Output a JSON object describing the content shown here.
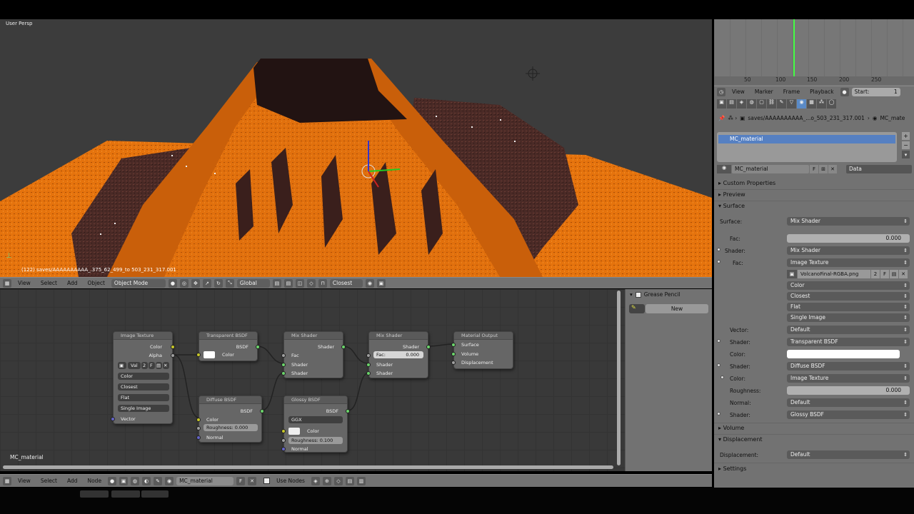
{
  "viewport": {
    "label": "User Persp",
    "status": "(122) saves/AAAAAAAAAA_.375_62_499_to 503_231_317.001"
  },
  "viewport_header": {
    "view": "View",
    "select": "Select",
    "add": "Add",
    "object": "Object",
    "mode": "Object Mode",
    "orientation": "Global",
    "snap": "Closest"
  },
  "node_editor": {
    "material_label": "MC_material",
    "nodes": {
      "image_texture": {
        "title": "Image Texture",
        "out_color": "Color",
        "out_alpha": "Alpha",
        "img_name": "Val",
        "img_users": "2",
        "fake": "F",
        "interp": "Color",
        "extension": "Closest",
        "projection": "Flat",
        "source": "Single Image",
        "in_vector": "Vector"
      },
      "transparent": {
        "title": "Transparent BSDF",
        "out": "BSDF",
        "in_color": "Color"
      },
      "diffuse": {
        "title": "Diffuse BSDF",
        "out": "BSDF",
        "in_color": "Color",
        "roughness": "Roughness:  0.000",
        "in_normal": "Normal"
      },
      "mix1": {
        "title": "Mix Shader",
        "out": "Shader",
        "in_fac": "Fac",
        "in_s1": "Shader",
        "in_s2": "Shader"
      },
      "glossy": {
        "title": "Glossy BSDF",
        "out": "BSDF",
        "dist": "GGX",
        "in_color": "Color",
        "roughness": "Roughness:  0.100",
        "in_normal": "Normal"
      },
      "mix2": {
        "title": "Mix Shader",
        "out": "Shader",
        "fac_label": "Fac:",
        "fac_val": "0.000",
        "in_s1": "Shader",
        "in_s2": "Shader"
      },
      "output": {
        "title": "Material Output",
        "surface": "Surface",
        "volume": "Volume",
        "displacement": "Displacement"
      }
    }
  },
  "node_header": {
    "view": "View",
    "select": "Select",
    "add": "Add",
    "node": "Node",
    "material": "MC_material",
    "fake": "F",
    "use_nodes": "Use Nodes"
  },
  "grease_pencil": {
    "title": "Grease Pencil",
    "new_label": "New"
  },
  "timeline": {
    "ticks": [
      "50",
      "100",
      "150",
      "200",
      "250"
    ],
    "menu": [
      "View",
      "Marker",
      "Frame",
      "Playback"
    ],
    "start_label": "Start:",
    "start_val": "1"
  },
  "properties": {
    "breadcrumb_path": "saves/AAAAAAAAAA_...o_503_231_317.001",
    "breadcrumb_mat": "MC_mate",
    "slot": "MC_material",
    "datablock": "MC_material",
    "fake": "F",
    "link": "Data",
    "sections": {
      "custom": "Custom Properties",
      "preview": "Preview",
      "surface": "Surface",
      "volume": "Volume",
      "displacement": "Displacement",
      "settings": "Settings"
    },
    "rows": {
      "surface_lbl": "Surface:",
      "surface_val": "Mix Shader",
      "fac_lbl": "Fac:",
      "fac_val": "0.000",
      "shader1_lbl": "Shader:",
      "shader1_val": "Mix Shader",
      "fac2_lbl": "Fac:",
      "fac2_val": "Image Texture",
      "img_name": "VolcanoFinal-RGBA.png",
      "img_users": "2",
      "img_fake": "F",
      "opt1": "Color",
      "opt2": "Closest",
      "opt3": "Flat",
      "opt4": "Single Image",
      "vector_lbl": "Vector:",
      "vector_val": "Default",
      "shader2_lbl": "Shader:",
      "shader2_val": "Transparent BSDF",
      "color_lbl": "Color:",
      "shader3_lbl": "Shader:",
      "shader3_val": "Diffuse BSDF",
      "color2_lbl": "Color:",
      "color2_val": "Image Texture",
      "rough_lbl": "Roughness:",
      "rough_val": "0.000",
      "normal_lbl": "Normal:",
      "normal_val": "Default",
      "shader4_lbl": "Shader:",
      "shader4_val": "Glossy BSDF",
      "disp_lbl": "Displacement:",
      "disp_val": "Default"
    }
  }
}
